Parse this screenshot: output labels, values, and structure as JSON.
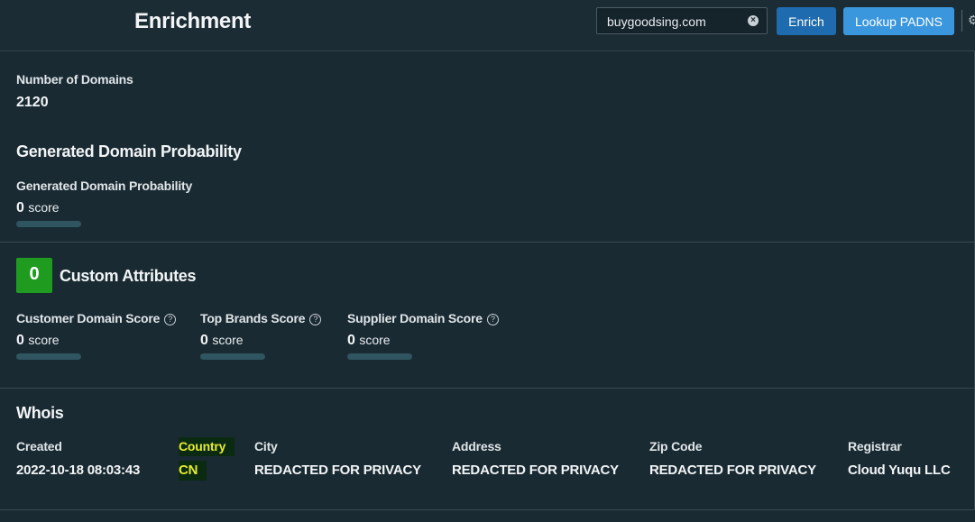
{
  "header": {
    "title": "Enrichment",
    "search_value": "buygoodsing.com",
    "enrich_label": "Enrich",
    "lookup_label": "Lookup PADNS"
  },
  "domain_info": {
    "number_label": "Number of Domains",
    "number_value": "2120"
  },
  "generated": {
    "heading": "Generated Domain Probability",
    "label": "Generated Domain Probability",
    "score": "0",
    "unit": "score",
    "fraction": 0
  },
  "custom": {
    "count": "0",
    "heading": "Custom Attributes",
    "items": [
      {
        "label": "Customer Domain Score",
        "score": "0",
        "unit": "score",
        "fraction": 0
      },
      {
        "label": "Top Brands Score",
        "score": "0",
        "unit": "score",
        "fraction": 0
      },
      {
        "label": "Supplier Domain Score",
        "score": "0",
        "unit": "score",
        "fraction": 0
      }
    ]
  },
  "whois": {
    "heading": "Whois",
    "created_label": "Created",
    "created_value": "2022-10-18 08:03:43",
    "country_label": "Country",
    "country_value": "CN",
    "city_label": "City",
    "city_value": "REDACTED FOR PRIVACY",
    "address_label": "Address",
    "address_value": "REDACTED FOR PRIVACY",
    "zip_label": "Zip Code",
    "zip_value": "REDACTED FOR PRIVACY",
    "registrar_label": "Registrar",
    "registrar_value": "Cloud Yuqu LLC"
  },
  "colors": {
    "accent_green": "#1f9b20",
    "button_blue": "#1f6bb0",
    "button_light_blue": "#3b97dd",
    "highlight": "#e6ec2c"
  }
}
